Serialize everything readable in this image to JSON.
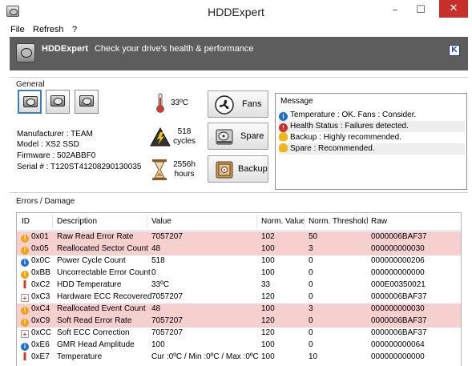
{
  "window": {
    "title": "HDDExpert"
  },
  "menu": {
    "items": [
      {
        "label": "File"
      },
      {
        "label": "Refresh"
      },
      {
        "label": "?"
      }
    ]
  },
  "banner": {
    "app_name": "HDDExpert",
    "tagline": "Check your drive's health & performance",
    "corner_icon": "k-logo-icon"
  },
  "general": {
    "label": "General",
    "drives": [
      {
        "icon": "hdd-icon",
        "selected": true
      },
      {
        "icon": "hdd-icon",
        "selected": false
      },
      {
        "icon": "hdd-icon",
        "selected": false
      }
    ],
    "manufacturer": "Manufacturer : TEAM",
    "model": "Model : XS2 SSD",
    "firmware": "Firmware : 502ABBF0",
    "serial": "Serial # : T120ST41208290130035",
    "temperature": "33ºC",
    "cycles_value": "518",
    "cycles_label": "cycles",
    "hours_value": "2556h",
    "hours_label": "hours"
  },
  "buttons": {
    "fans": "Fans",
    "spare": "Spare",
    "backup": "Backup"
  },
  "messages": {
    "title": "Message",
    "rows": [
      {
        "icon": "info-icon",
        "color": "#1f6fd0",
        "text": "Temperature : OK. Fans : Consider."
      },
      {
        "icon": "error-icon",
        "color": "#d42a2a",
        "text": "Health Status : Failures detected."
      },
      {
        "icon": "bulb-icon",
        "color": "#f2b519",
        "text": "Backup : Highly recommended."
      },
      {
        "icon": "bulb-icon",
        "color": "#f2b519",
        "text": "Spare : Recommended."
      }
    ]
  },
  "errors": {
    "label": "Errors / Damage",
    "columns": [
      "ID",
      "Description",
      "Value",
      "Norm. Value",
      "Norm. Threshold",
      "Raw"
    ],
    "rows": [
      {
        "icon": "warning-icon",
        "id": "0x01",
        "desc": "Raw Read Error Rate",
        "value": "7057207",
        "norm": "102",
        "thr": "50",
        "raw": "0000006BAF37",
        "warn": true
      },
      {
        "icon": "warning-icon",
        "id": "0x05",
        "desc": "Reallocated Sector Count",
        "value": "48",
        "norm": "100",
        "thr": "3",
        "raw": "000000000030",
        "warn": true
      },
      {
        "icon": "info-icon",
        "id": "0x0C",
        "desc": "Power Cycle Count",
        "value": "518",
        "norm": "100",
        "thr": "0",
        "raw": "000000000206",
        "warn": false
      },
      {
        "icon": "warning-icon",
        "id": "0xBB",
        "desc": "Uncorrectable Error Count",
        "value": "0",
        "norm": "100",
        "thr": "0",
        "raw": "000000000000",
        "warn": false
      },
      {
        "icon": "thermometer-icon",
        "id": "0xC2",
        "desc": "HDD Temperature",
        "value": "33ºC",
        "norm": "33",
        "thr": "0",
        "raw": "000E00350021",
        "warn": false
      },
      {
        "icon": "medical-icon",
        "id": "0xC3",
        "desc": "Hardware ECC Recovered",
        "value": "7057207",
        "norm": "120",
        "thr": "0",
        "raw": "0000006BAF37",
        "warn": false
      },
      {
        "icon": "warning-icon",
        "id": "0xC4",
        "desc": "Reallocated Event Count",
        "value": "48",
        "norm": "100",
        "thr": "3",
        "raw": "000000000030",
        "warn": true
      },
      {
        "icon": "warning-icon",
        "id": "0xC9",
        "desc": "Soft Read Error Rate",
        "value": "7057207",
        "norm": "120",
        "thr": "0",
        "raw": "0000006BAF37",
        "warn": true
      },
      {
        "icon": "medical-icon",
        "id": "0xCC",
        "desc": "Soft ECC Correction",
        "value": "7057207",
        "norm": "120",
        "thr": "0",
        "raw": "0000006BAF37",
        "warn": false
      },
      {
        "icon": "info-icon",
        "id": "0xE6",
        "desc": "GMR Head Amplitude",
        "value": "100",
        "norm": "100",
        "thr": "0",
        "raw": "000000000064",
        "warn": false
      },
      {
        "icon": "thermometer-icon",
        "id": "0xE7",
        "desc": "Temperature",
        "value": "Cur :0ºC / Min :0ºC / Max :0ºC",
        "norm": "100",
        "thr": "10",
        "raw": "000000000000",
        "warn": false
      }
    ]
  }
}
